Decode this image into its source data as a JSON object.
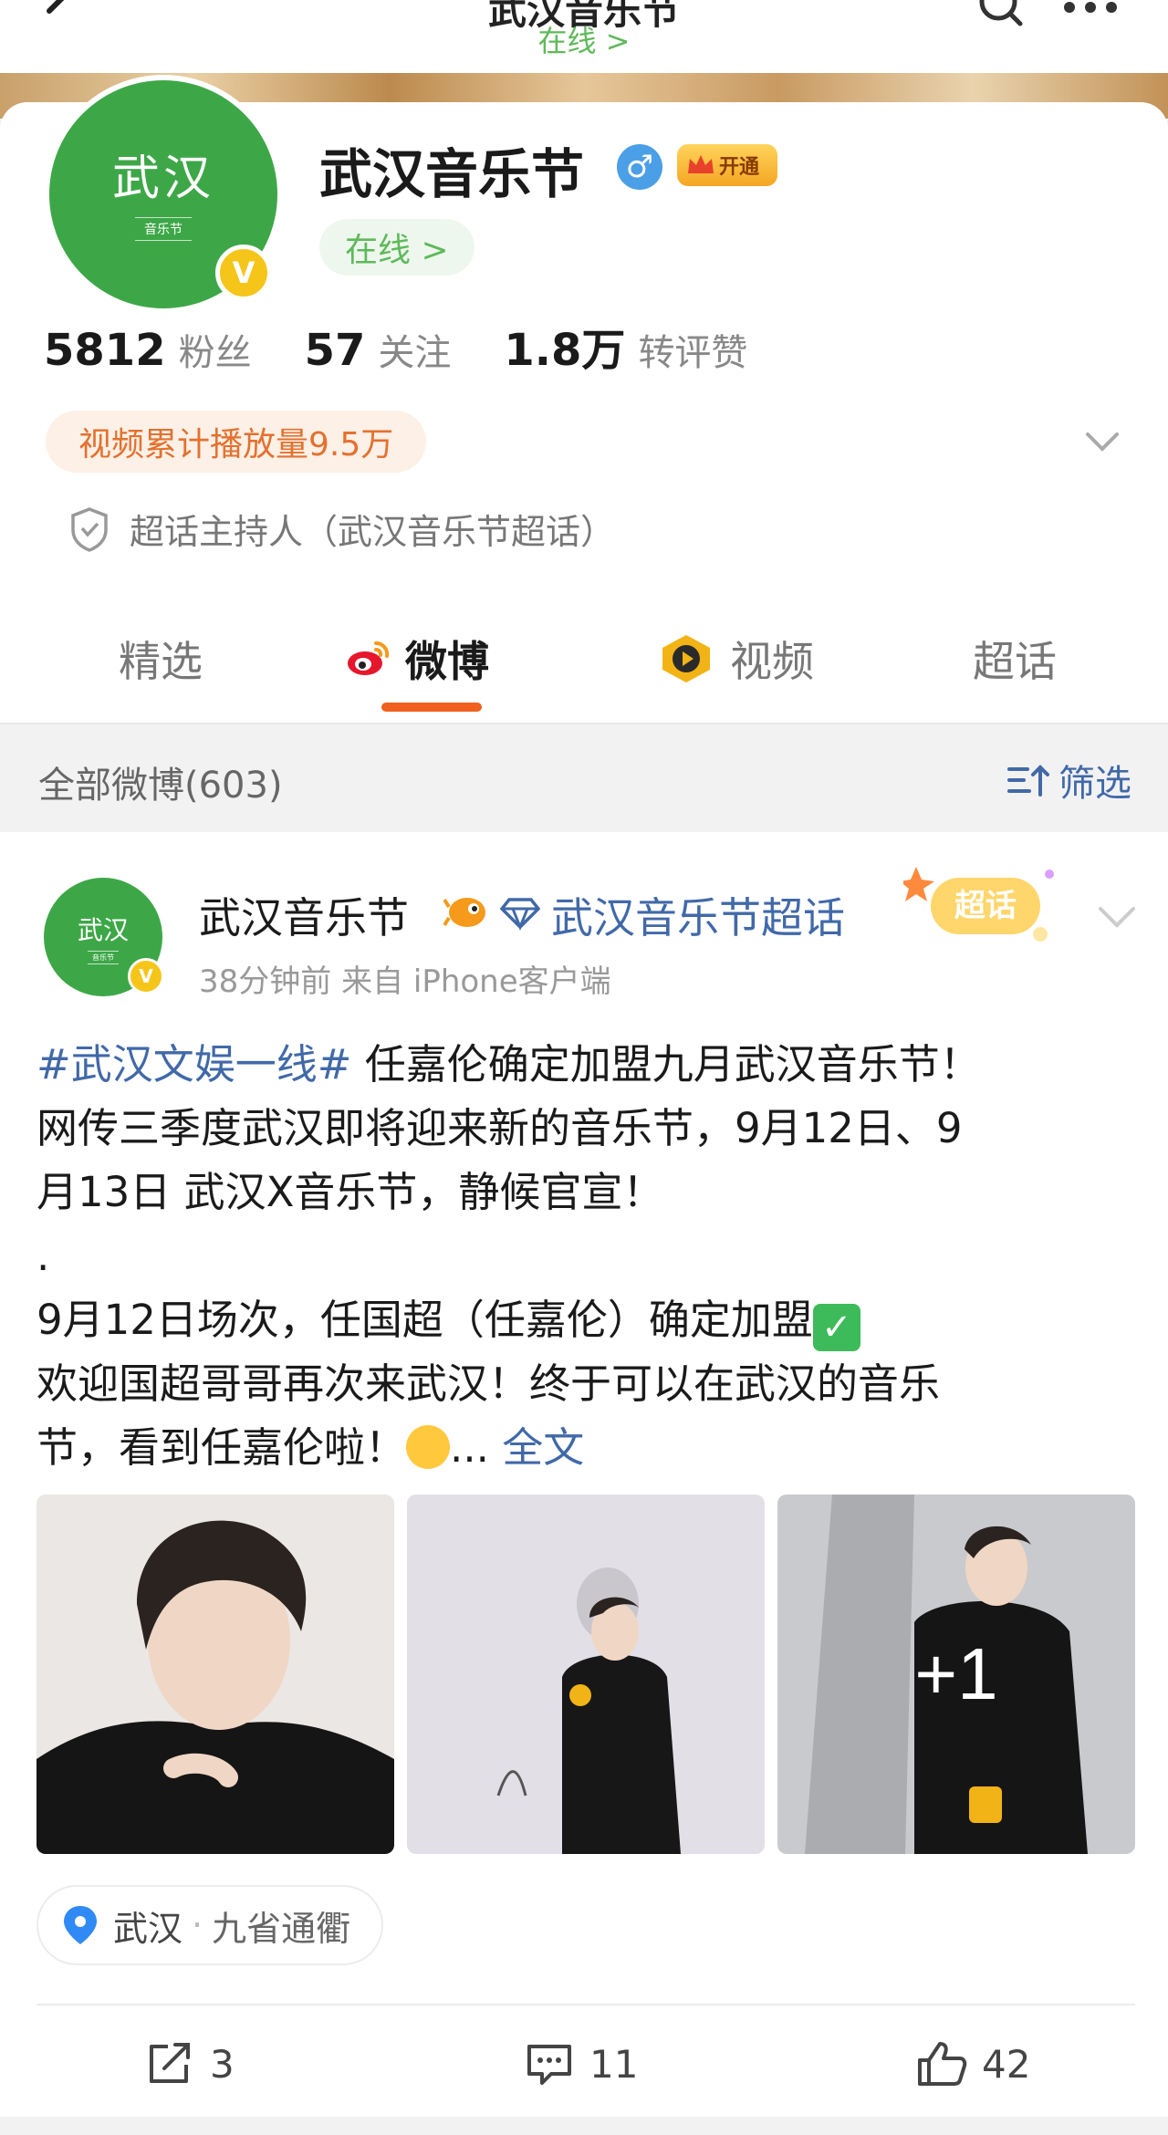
{
  "header": {
    "title": "武汉音乐节",
    "status": "在线 >"
  },
  "profile": {
    "avatar_text": "武汉",
    "avatar_sub": "音乐节",
    "name": "武汉音乐节",
    "vip_label": "开通",
    "online_label": "在线 >",
    "stats": [
      {
        "value": "5812",
        "label": "粉丝"
      },
      {
        "value": "57",
        "label": "关注"
      },
      {
        "value": "1.8万",
        "label": "转评赞"
      }
    ],
    "views_label": "视频累计播放量9.5万",
    "host_label": "超话主持人（武汉音乐节超话）"
  },
  "tabs": [
    {
      "label": "精选"
    },
    {
      "label": "微博"
    },
    {
      "label": "视频"
    },
    {
      "label": "超话"
    }
  ],
  "filter_bar": {
    "count_label": "全部微博(603)",
    "filter_label": "筛选"
  },
  "post": {
    "author": "武汉音乐节",
    "avatar_text": "武汉",
    "avatar_sub": "音乐节",
    "topic": "武汉音乐节超话",
    "badge_label": "超话",
    "meta": "38分钟前  来自 iPhone客户端",
    "hashtag": "#武汉文娱一线#",
    "line1": " 任嘉伦确定加盟九月武汉音乐节！",
    "line2": "网传三季度武汉即将迎来新的音乐节，9月12日、9",
    "line3": "月13日 武汉X音乐节，静候官宣！",
    "line4": ".",
    "line5": "9月12日场次，任国超（任嘉伦）确定加盟",
    "line6": "欢迎国超哥哥再次来武汉！终于可以在武汉的音乐",
    "line7": "节，看到任嘉伦啦！",
    "ellipsis": "... ",
    "more_label": "全文",
    "photo_more": "+1",
    "location": "武汉",
    "location_sep": "·",
    "location_sub": "九省通衢",
    "reposts": "3",
    "comments": "11",
    "likes": "42"
  }
}
